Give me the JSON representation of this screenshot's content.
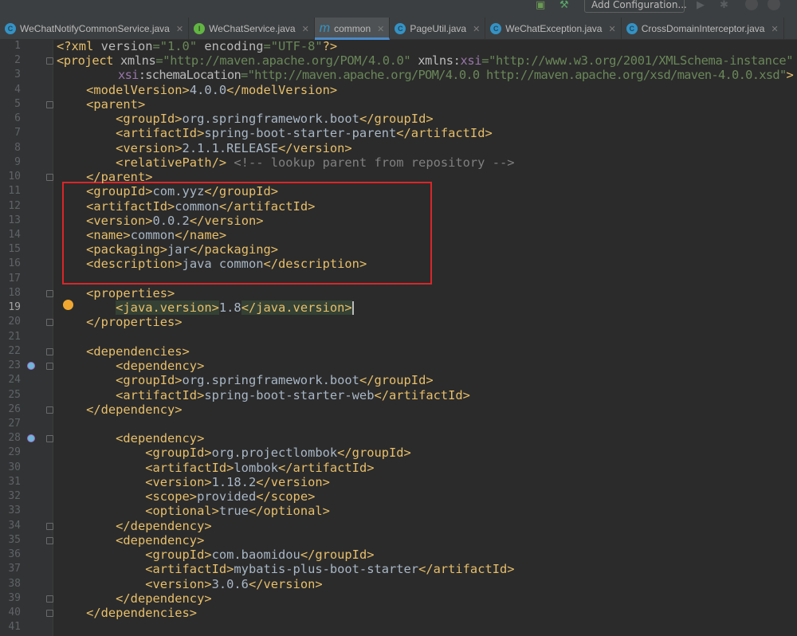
{
  "toolbar": {
    "add_configuration": "Add Configuration..."
  },
  "tabs": [
    {
      "label": "WeChatNotifyCommonService.java",
      "icon": "C",
      "kind": "class"
    },
    {
      "label": "WeChatService.java",
      "icon": "I",
      "kind": "interface"
    },
    {
      "label": "common",
      "icon": "m",
      "kind": "maven",
      "active": true
    },
    {
      "label": "PageUtil.java",
      "icon": "C",
      "kind": "class"
    },
    {
      "label": "WeChatException.java",
      "icon": "C",
      "kind": "class"
    },
    {
      "label": "CrossDomainInterceptor.java",
      "icon": "C",
      "kind": "class"
    }
  ],
  "colors": {
    "tag": "#e8bf6a",
    "text": "#a9b7c6",
    "string": "#6a8759",
    "attr": "#bababa",
    "comment": "#808080",
    "namespace": "#9876aa",
    "highlight_box": "#d9262a",
    "background": "#2b2b2b"
  },
  "current_line": 19,
  "lines": [
    [
      [
        "t",
        "<?xml "
      ],
      [
        "a",
        "version"
      ],
      [
        "s",
        "=\"1.0\" "
      ],
      [
        "a",
        "encoding"
      ],
      [
        "s",
        "=\"UTF-8\""
      ],
      [
        "t",
        "?>"
      ]
    ],
    [
      [
        "t",
        "<project "
      ],
      [
        "a",
        "xmlns"
      ],
      [
        "s",
        "=\"http://maven.apache.org/POM/4.0.0\" "
      ],
      [
        "a",
        "xmlns:"
      ],
      [
        "n",
        "xsi"
      ],
      [
        "s",
        "=\"http://www.w3.org/2001/XMLSchema-instance\""
      ]
    ],
    [
      [
        "x",
        "         "
      ],
      [
        "n",
        "xsi"
      ],
      [
        "a",
        ":schemaLocation"
      ],
      [
        "s",
        "=\"http://maven.apache.org/POM/4.0.0 http://maven.apache.org/xsd/maven-4.0.0.xsd\""
      ],
      [
        "t",
        ">"
      ]
    ],
    [
      [
        "x",
        "    "
      ],
      [
        "t",
        "<modelVersion>"
      ],
      [
        "x",
        "4.0.0"
      ],
      [
        "t",
        "</modelVersion>"
      ]
    ],
    [
      [
        "x",
        "    "
      ],
      [
        "t",
        "<parent>"
      ]
    ],
    [
      [
        "x",
        "        "
      ],
      [
        "t",
        "<groupId>"
      ],
      [
        "x",
        "org.springframework.boot"
      ],
      [
        "t",
        "</groupId>"
      ]
    ],
    [
      [
        "x",
        "        "
      ],
      [
        "t",
        "<artifactId>"
      ],
      [
        "x",
        "spring-boot-starter-parent"
      ],
      [
        "t",
        "</artifactId>"
      ]
    ],
    [
      [
        "x",
        "        "
      ],
      [
        "t",
        "<version>"
      ],
      [
        "x",
        "2.1.1.RELEASE"
      ],
      [
        "t",
        "</version>"
      ]
    ],
    [
      [
        "x",
        "        "
      ],
      [
        "t",
        "<relativePath/>"
      ],
      [
        "c",
        " <!-- lookup parent from repository -->"
      ]
    ],
    [
      [
        "x",
        "    "
      ],
      [
        "t",
        "</parent>"
      ]
    ],
    [
      [
        "x",
        "    "
      ],
      [
        "t",
        "<groupId>"
      ],
      [
        "x",
        "com.yyz"
      ],
      [
        "t",
        "</groupId>"
      ]
    ],
    [
      [
        "x",
        "    "
      ],
      [
        "t",
        "<artifactId>"
      ],
      [
        "x",
        "common"
      ],
      [
        "t",
        "</artifactId>"
      ]
    ],
    [
      [
        "x",
        "    "
      ],
      [
        "t",
        "<version>"
      ],
      [
        "x",
        "0.0.2"
      ],
      [
        "t",
        "</version>"
      ]
    ],
    [
      [
        "x",
        "    "
      ],
      [
        "t",
        "<name>"
      ],
      [
        "x",
        "common"
      ],
      [
        "t",
        "</name>"
      ]
    ],
    [
      [
        "x",
        "    "
      ],
      [
        "t",
        "<packaging>"
      ],
      [
        "x",
        "jar"
      ],
      [
        "t",
        "</packaging>"
      ]
    ],
    [
      [
        "x",
        "    "
      ],
      [
        "t",
        "<description>"
      ],
      [
        "x",
        "java common"
      ],
      [
        "t",
        "</description>"
      ]
    ],
    [],
    [
      [
        "x",
        "    "
      ],
      [
        "t",
        "<properties>"
      ]
    ],
    [
      [
        "x",
        "        "
      ],
      [
        "t hl",
        "<java.version>"
      ],
      [
        "x",
        "1.8"
      ],
      [
        "t hl",
        "</java.version>"
      ]
    ],
    [
      [
        "x",
        "    "
      ],
      [
        "t",
        "</properties>"
      ]
    ],
    [],
    [
      [
        "x",
        "    "
      ],
      [
        "t",
        "<dependencies>"
      ]
    ],
    [
      [
        "x",
        "        "
      ],
      [
        "t",
        "<dependency>"
      ]
    ],
    [
      [
        "x",
        "        "
      ],
      [
        "t",
        "<groupId>"
      ],
      [
        "x",
        "org.springframework.boot"
      ],
      [
        "t",
        "</groupId>"
      ]
    ],
    [
      [
        "x",
        "        "
      ],
      [
        "t",
        "<artifactId>"
      ],
      [
        "x",
        "spring-boot-starter-web"
      ],
      [
        "t",
        "</artifactId>"
      ]
    ],
    [
      [
        "x",
        "    "
      ],
      [
        "t",
        "</dependency>"
      ]
    ],
    [],
    [
      [
        "x",
        "        "
      ],
      [
        "t",
        "<dependency>"
      ]
    ],
    [
      [
        "x",
        "            "
      ],
      [
        "t",
        "<groupId>"
      ],
      [
        "x",
        "org.projectlombok"
      ],
      [
        "t",
        "</groupId>"
      ]
    ],
    [
      [
        "x",
        "            "
      ],
      [
        "t",
        "<artifactId>"
      ],
      [
        "x",
        "lombok"
      ],
      [
        "t",
        "</artifactId>"
      ]
    ],
    [
      [
        "x",
        "            "
      ],
      [
        "t",
        "<version>"
      ],
      [
        "x",
        "1.18.2"
      ],
      [
        "t",
        "</version>"
      ]
    ],
    [
      [
        "x",
        "            "
      ],
      [
        "t",
        "<scope>"
      ],
      [
        "x",
        "provided"
      ],
      [
        "t",
        "</scope>"
      ]
    ],
    [
      [
        "x",
        "            "
      ],
      [
        "t",
        "<optional>"
      ],
      [
        "x",
        "true"
      ],
      [
        "t",
        "</optional>"
      ]
    ],
    [
      [
        "x",
        "        "
      ],
      [
        "t",
        "</dependency>"
      ]
    ],
    [
      [
        "x",
        "        "
      ],
      [
        "t",
        "<dependency>"
      ]
    ],
    [
      [
        "x",
        "            "
      ],
      [
        "t",
        "<groupId>"
      ],
      [
        "x",
        "com.baomidou"
      ],
      [
        "t",
        "</groupId>"
      ]
    ],
    [
      [
        "x",
        "            "
      ],
      [
        "t",
        "<artifactId>"
      ],
      [
        "x",
        "mybatis-plus-boot-starter"
      ],
      [
        "t",
        "</artifactId>"
      ]
    ],
    [
      [
        "x",
        "            "
      ],
      [
        "t",
        "<version>"
      ],
      [
        "x",
        "3.0.6"
      ],
      [
        "t",
        "</version>"
      ]
    ],
    [
      [
        "x",
        "        "
      ],
      [
        "t",
        "</dependency>"
      ]
    ],
    [
      [
        "x",
        "    "
      ],
      [
        "t",
        "</dependencies>"
      ]
    ],
    []
  ],
  "fold_lines": [
    2,
    5,
    10,
    18,
    20,
    22,
    23,
    26,
    28,
    34,
    35,
    39,
    40
  ],
  "maven_marker_lines": [
    23,
    28
  ]
}
